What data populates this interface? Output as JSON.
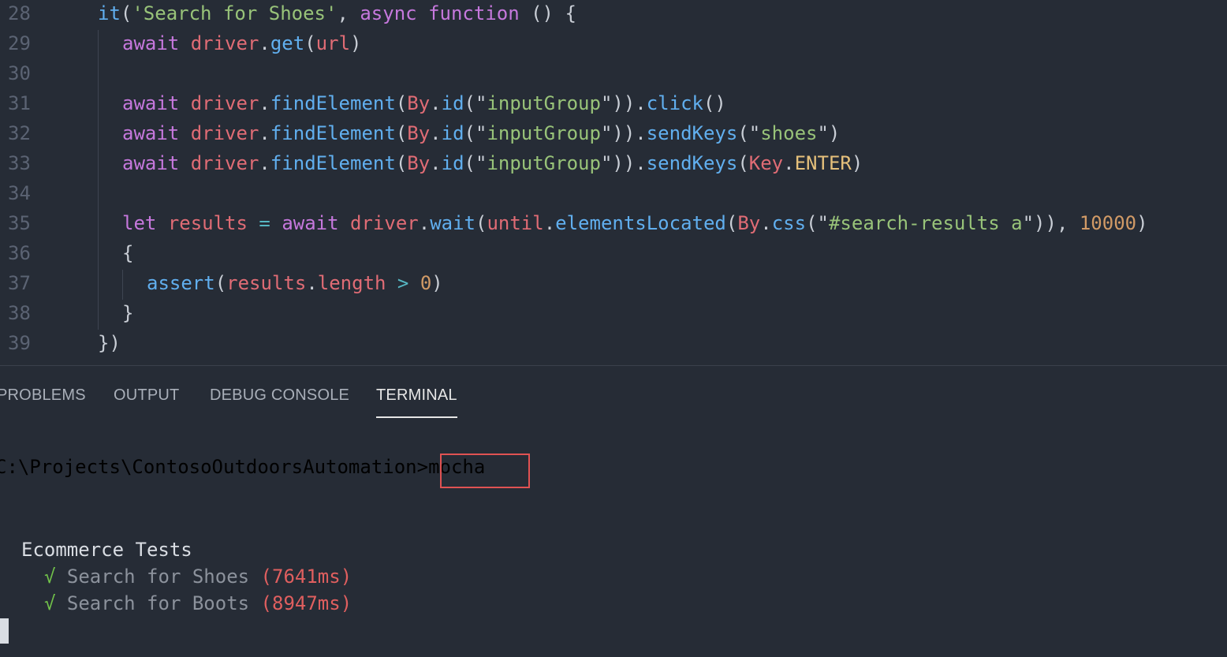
{
  "editor": {
    "lines": [
      {
        "num": "28",
        "tokens": [
          [
            "t-fn",
            "it"
          ],
          [
            "t-pun",
            "("
          ],
          [
            "t-str",
            "'Search for Shoes'"
          ],
          [
            "t-pun",
            ", "
          ],
          [
            "t-kw",
            "async"
          ],
          [
            "t-pun",
            " "
          ],
          [
            "t-kw",
            "function"
          ],
          [
            "t-pun",
            " () {"
          ]
        ],
        "indent": 0
      },
      {
        "num": "29",
        "tokens": [
          [
            "t-kw",
            "await"
          ],
          [
            "t-pun",
            " "
          ],
          [
            "t-var",
            "driver"
          ],
          [
            "t-pun",
            "."
          ],
          [
            "t-fn",
            "get"
          ],
          [
            "t-pun",
            "("
          ],
          [
            "t-var",
            "url"
          ],
          [
            "t-pun",
            ")"
          ]
        ],
        "indent": 1
      },
      {
        "num": "30",
        "tokens": [],
        "indent": 1
      },
      {
        "num": "31",
        "tokens": [
          [
            "t-kw",
            "await"
          ],
          [
            "t-pun",
            " "
          ],
          [
            "t-var",
            "driver"
          ],
          [
            "t-pun",
            "."
          ],
          [
            "t-fn",
            "findElement"
          ],
          [
            "t-pun",
            "("
          ],
          [
            "t-var",
            "By"
          ],
          [
            "t-pun",
            "."
          ],
          [
            "t-fn",
            "id"
          ],
          [
            "t-pun",
            "(\""
          ],
          [
            "t-str",
            "inputGroup"
          ],
          [
            "t-pun",
            "\"))."
          ],
          [
            "t-fn",
            "click"
          ],
          [
            "t-pun",
            "()"
          ]
        ],
        "indent": 1
      },
      {
        "num": "32",
        "tokens": [
          [
            "t-kw",
            "await"
          ],
          [
            "t-pun",
            " "
          ],
          [
            "t-var",
            "driver"
          ],
          [
            "t-pun",
            "."
          ],
          [
            "t-fn",
            "findElement"
          ],
          [
            "t-pun",
            "("
          ],
          [
            "t-var",
            "By"
          ],
          [
            "t-pun",
            "."
          ],
          [
            "t-fn",
            "id"
          ],
          [
            "t-pun",
            "(\""
          ],
          [
            "t-str",
            "inputGroup"
          ],
          [
            "t-pun",
            "\"))."
          ],
          [
            "t-fn",
            "sendKeys"
          ],
          [
            "t-pun",
            "(\""
          ],
          [
            "t-str",
            "shoes"
          ],
          [
            "t-pun",
            "\")"
          ]
        ],
        "indent": 1
      },
      {
        "num": "33",
        "tokens": [
          [
            "t-kw",
            "await"
          ],
          [
            "t-pun",
            " "
          ],
          [
            "t-var",
            "driver"
          ],
          [
            "t-pun",
            "."
          ],
          [
            "t-fn",
            "findElement"
          ],
          [
            "t-pun",
            "("
          ],
          [
            "t-var",
            "By"
          ],
          [
            "t-pun",
            "."
          ],
          [
            "t-fn",
            "id"
          ],
          [
            "t-pun",
            "(\""
          ],
          [
            "t-str",
            "inputGroup"
          ],
          [
            "t-pun",
            "\"))."
          ],
          [
            "t-fn",
            "sendKeys"
          ],
          [
            "t-pun",
            "("
          ],
          [
            "t-var",
            "Key"
          ],
          [
            "t-pun",
            "."
          ],
          [
            "t-const",
            "ENTER"
          ],
          [
            "t-pun",
            ")"
          ]
        ],
        "indent": 1
      },
      {
        "num": "34",
        "tokens": [],
        "indent": 1
      },
      {
        "num": "35",
        "tokens": [
          [
            "t-kw",
            "let"
          ],
          [
            "t-pun",
            " "
          ],
          [
            "t-var",
            "results"
          ],
          [
            "t-pun",
            " "
          ],
          [
            "t-op",
            "="
          ],
          [
            "t-pun",
            " "
          ],
          [
            "t-kw",
            "await"
          ],
          [
            "t-pun",
            " "
          ],
          [
            "t-var",
            "driver"
          ],
          [
            "t-pun",
            "."
          ],
          [
            "t-fn",
            "wait"
          ],
          [
            "t-pun",
            "("
          ],
          [
            "t-var",
            "until"
          ],
          [
            "t-pun",
            "."
          ],
          [
            "t-fn",
            "elementsLocated"
          ],
          [
            "t-pun",
            "("
          ],
          [
            "t-var",
            "By"
          ],
          [
            "t-pun",
            "."
          ],
          [
            "t-fn",
            "css"
          ],
          [
            "t-pun",
            "(\""
          ],
          [
            "t-str",
            "#search-results a"
          ],
          [
            "t-pun",
            "\")), "
          ],
          [
            "t-num",
            "10000"
          ],
          [
            "t-pun",
            ")"
          ]
        ],
        "indent": 1
      },
      {
        "num": "36",
        "tokens": [
          [
            "t-pun",
            "{"
          ]
        ],
        "indent": 1
      },
      {
        "num": "37",
        "tokens": [
          [
            "t-fn",
            "assert"
          ],
          [
            "t-pun",
            "("
          ],
          [
            "t-var",
            "results"
          ],
          [
            "t-pun",
            "."
          ],
          [
            "t-var",
            "length"
          ],
          [
            "t-pun",
            " "
          ],
          [
            "t-op",
            ">"
          ],
          [
            "t-pun",
            " "
          ],
          [
            "t-num",
            "0"
          ],
          [
            "t-pun",
            ")"
          ]
        ],
        "indent": 2
      },
      {
        "num": "38",
        "tokens": [
          [
            "t-pun",
            "}"
          ]
        ],
        "indent": 1
      },
      {
        "num": "39",
        "tokens": [
          [
            "t-pun",
            "})"
          ]
        ],
        "indent": 0
      }
    ]
  },
  "panel": {
    "tabs": [
      {
        "label": "PROBLEMS",
        "active": false
      },
      {
        "label": "OUTPUT",
        "active": false
      },
      {
        "label": "DEBUG CONSOLE",
        "active": false
      },
      {
        "label": "TERMINAL",
        "active": true
      }
    ]
  },
  "terminal": {
    "prompt": "C:\\Projects\\ContosoOutdoorsAutomation>",
    "command": "mocha",
    "suite": "Ecommerce Tests",
    "tests": [
      {
        "check": "√",
        "name": "Search for Shoes",
        "duration": "(7641ms)"
      },
      {
        "check": "√",
        "name": "Search for Boots",
        "duration": "(8947ms)"
      }
    ]
  },
  "colors": {
    "background": "#262c36",
    "highlight_box": "#e05252",
    "pass_check": "#71c24a",
    "duration": "#e05f5f"
  }
}
